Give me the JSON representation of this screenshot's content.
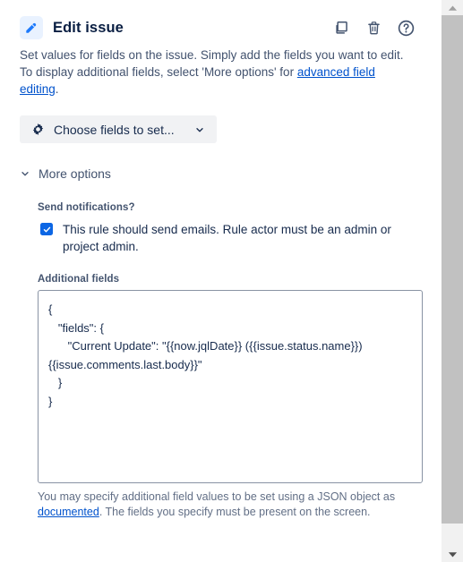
{
  "header": {
    "title": "Edit issue",
    "edit_icon": "pencil-icon",
    "actions": [
      {
        "name": "duplicate-icon",
        "label": "Duplicate"
      },
      {
        "name": "delete-icon",
        "label": "Delete"
      },
      {
        "name": "help-icon",
        "label": "Help"
      }
    ]
  },
  "intro": {
    "line1": "Set values for fields on the issue. Simply add the fields you want to edit.",
    "line2_prefix": "To display additional fields, select 'More options' for ",
    "line2_link": "advanced field editing",
    "line2_suffix": "."
  },
  "choose_fields": {
    "label": "Choose fields to set...",
    "gear_icon": "gear-icon",
    "chevron_icon": "chevron-down-icon"
  },
  "more_options": {
    "label": "More options",
    "chevron_icon": "chevron-down-icon",
    "expanded": true
  },
  "send_notifications": {
    "label": "Send notifications?",
    "checkbox_label": "This rule should send emails. Rule actor must be an admin or project admin.",
    "checked": true,
    "check_icon": "check-icon",
    "accent_color": "#0c66e4"
  },
  "additional_fields": {
    "label": "Additional fields",
    "value": "{\n   \"fields\": {\n      \"Current Update\": \"{{now.jqlDate}} ({{issue.status.name}}) {{issue.comments.last.body}}\"\n   }\n}",
    "placeholder": "",
    "help_prefix": "You may specify additional field values to be set using a JSON object as ",
    "help_link": "documented",
    "help_suffix": ". The fields you specify must be present on the screen."
  },
  "scrollbar": {
    "up_icon": "triangle-up-icon",
    "down_icon": "triangle-down-icon",
    "thumb": "scrollbar-thumb"
  },
  "colors": {
    "link": "#0052cc",
    "title": "#091e42",
    "icon": "#44546f",
    "accent": "#0c66e4"
  }
}
